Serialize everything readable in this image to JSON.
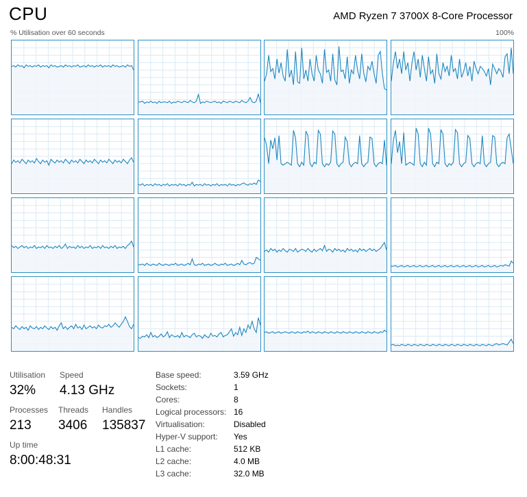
{
  "header": {
    "title": "CPU",
    "processor": "AMD Ryzen 7 3700X 8-Core Processor",
    "graph_caption": "% Utilisation over 60 seconds",
    "graph_max": "100%"
  },
  "colors": {
    "line": "#1c86c0",
    "fill": "#f1f6fb",
    "grid": "#d9eaf4",
    "border": "#2a8fc2"
  },
  "graphs": [
    {
      "logical_processor": 1,
      "levels": [
        0.65,
        0.66,
        0.64,
        0.67,
        0.65,
        0.66,
        0.63,
        0.67,
        0.65,
        0.66,
        0.64,
        0.66,
        0.65,
        0.67,
        0.64,
        0.66,
        0.65,
        0.66,
        0.63,
        0.67,
        0.65,
        0.66,
        0.64,
        0.65,
        0.66,
        0.64,
        0.67,
        0.65,
        0.66,
        0.64,
        0.66,
        0.65,
        0.67,
        0.64,
        0.65,
        0.66,
        0.64,
        0.67,
        0.65,
        0.66,
        0.64,
        0.66,
        0.65,
        0.67,
        0.64,
        0.66,
        0.65,
        0.66,
        0.64,
        0.67,
        0.65,
        0.66,
        0.64,
        0.65,
        0.66,
        0.64,
        0.67,
        0.65,
        0.66,
        0.6
      ]
    },
    {
      "logical_processor": 2,
      "levels": [
        0.17,
        0.17,
        0.18,
        0.15,
        0.17,
        0.16,
        0.18,
        0.16,
        0.17,
        0.15,
        0.18,
        0.16,
        0.17,
        0.17,
        0.16,
        0.18,
        0.15,
        0.17,
        0.16,
        0.18,
        0.17,
        0.16,
        0.18,
        0.17,
        0.16,
        0.19,
        0.17,
        0.16,
        0.18,
        0.27,
        0.15,
        0.17,
        0.16,
        0.18,
        0.17,
        0.16,
        0.17,
        0.18,
        0.16,
        0.17,
        0.15,
        0.18,
        0.17,
        0.16,
        0.18,
        0.17,
        0.16,
        0.18,
        0.17,
        0.16,
        0.19,
        0.17,
        0.16,
        0.18,
        0.23,
        0.17,
        0.16,
        0.18,
        0.28,
        0.16
      ]
    },
    {
      "logical_processor": 3,
      "levels": [
        0.45,
        0.55,
        0.8,
        0.58,
        0.62,
        0.48,
        0.75,
        0.56,
        0.7,
        0.52,
        0.45,
        0.88,
        0.5,
        0.6,
        0.4,
        0.85,
        0.44,
        0.42,
        0.9,
        0.48,
        0.6,
        0.45,
        0.75,
        0.55,
        0.45,
        0.8,
        0.6,
        0.55,
        0.42,
        0.88,
        0.57,
        0.6,
        0.45,
        0.82,
        0.47,
        0.4,
        0.92,
        0.58,
        0.6,
        0.48,
        0.78,
        0.42,
        0.6,
        0.55,
        0.8,
        0.6,
        0.48,
        0.82,
        0.56,
        0.44,
        0.65,
        0.6,
        0.72,
        0.55,
        0.42,
        0.8,
        0.85,
        0.55,
        0.35,
        0.33
      ]
    },
    {
      "logical_processor": 4,
      "levels": [
        0.45,
        0.7,
        0.85,
        0.62,
        0.75,
        0.55,
        0.85,
        0.6,
        0.7,
        0.45,
        0.7,
        0.85,
        0.6,
        0.75,
        0.5,
        0.8,
        0.62,
        0.45,
        0.78,
        0.55,
        0.6,
        0.42,
        0.82,
        0.55,
        0.48,
        0.7,
        0.58,
        0.65,
        0.52,
        0.8,
        0.58,
        0.62,
        0.48,
        0.75,
        0.5,
        0.58,
        0.7,
        0.52,
        0.65,
        0.45,
        0.72,
        0.62,
        0.55,
        0.65,
        0.62,
        0.58,
        0.52,
        0.62,
        0.4,
        0.68,
        0.62,
        0.55,
        0.62,
        0.58,
        0.5,
        0.78,
        0.82,
        0.55,
        0.9,
        0.55
      ]
    },
    {
      "logical_processor": 5,
      "levels": [
        0.4,
        0.45,
        0.42,
        0.44,
        0.41,
        0.46,
        0.43,
        0.4,
        0.45,
        0.42,
        0.44,
        0.41,
        0.47,
        0.43,
        0.4,
        0.45,
        0.42,
        0.44,
        0.38,
        0.46,
        0.43,
        0.41,
        0.45,
        0.42,
        0.44,
        0.41,
        0.46,
        0.43,
        0.4,
        0.45,
        0.42,
        0.44,
        0.41,
        0.46,
        0.43,
        0.4,
        0.45,
        0.42,
        0.44,
        0.41,
        0.46,
        0.43,
        0.4,
        0.45,
        0.42,
        0.44,
        0.41,
        0.46,
        0.43,
        0.4,
        0.45,
        0.42,
        0.44,
        0.41,
        0.46,
        0.43,
        0.4,
        0.45,
        0.48,
        0.42
      ]
    },
    {
      "logical_processor": 6,
      "levels": [
        0.12,
        0.11,
        0.13,
        0.1,
        0.12,
        0.11,
        0.12,
        0.1,
        0.13,
        0.11,
        0.12,
        0.1,
        0.12,
        0.11,
        0.13,
        0.1,
        0.12,
        0.11,
        0.12,
        0.1,
        0.13,
        0.11,
        0.12,
        0.1,
        0.12,
        0.11,
        0.15,
        0.1,
        0.12,
        0.11,
        0.12,
        0.1,
        0.13,
        0.11,
        0.12,
        0.1,
        0.12,
        0.11,
        0.13,
        0.1,
        0.12,
        0.11,
        0.12,
        0.1,
        0.13,
        0.11,
        0.12,
        0.1,
        0.12,
        0.11,
        0.13,
        0.14,
        0.12,
        0.11,
        0.13,
        0.12,
        0.14,
        0.12,
        0.18,
        0.16
      ]
    },
    {
      "logical_processor": 7,
      "levels": [
        0.75,
        0.65,
        0.4,
        0.72,
        0.6,
        0.75,
        0.45,
        0.78,
        0.4,
        0.38,
        0.4,
        0.42,
        0.4,
        0.38,
        0.85,
        0.75,
        0.4,
        0.36,
        0.42,
        0.38,
        0.84,
        0.78,
        0.4,
        0.36,
        0.42,
        0.4,
        0.85,
        0.8,
        0.4,
        0.36,
        0.4,
        0.38,
        0.42,
        0.84,
        0.8,
        0.4,
        0.36,
        0.4,
        0.42,
        0.76,
        0.7,
        0.4,
        0.36,
        0.4,
        0.42,
        0.4,
        0.78,
        0.4,
        0.36,
        0.4,
        0.42,
        0.76,
        0.74,
        0.4,
        0.36,
        0.4,
        0.42,
        0.4,
        0.72,
        0.38
      ]
    },
    {
      "logical_processor": 8,
      "levels": [
        0.4,
        0.72,
        0.85,
        0.55,
        0.7,
        0.4,
        0.82,
        0.38,
        0.4,
        0.42,
        0.4,
        0.38,
        0.88,
        0.8,
        0.4,
        0.36,
        0.42,
        0.38,
        0.88,
        0.8,
        0.4,
        0.36,
        0.42,
        0.4,
        0.86,
        0.8,
        0.4,
        0.36,
        0.4,
        0.38,
        0.42,
        0.86,
        0.82,
        0.4,
        0.36,
        0.4,
        0.42,
        0.78,
        0.74,
        0.4,
        0.36,
        0.4,
        0.42,
        0.4,
        0.78,
        0.4,
        0.36,
        0.4,
        0.42,
        0.78,
        0.76,
        0.4,
        0.36,
        0.4,
        0.42,
        0.4,
        0.75,
        0.8,
        0.6,
        0.4
      ]
    },
    {
      "logical_processor": 9,
      "levels": [
        0.36,
        0.33,
        0.35,
        0.32,
        0.34,
        0.36,
        0.33,
        0.35,
        0.32,
        0.34,
        0.33,
        0.36,
        0.32,
        0.34,
        0.33,
        0.35,
        0.32,
        0.36,
        0.33,
        0.34,
        0.32,
        0.35,
        0.33,
        0.36,
        0.32,
        0.34,
        0.38,
        0.32,
        0.35,
        0.33,
        0.34,
        0.32,
        0.36,
        0.33,
        0.35,
        0.32,
        0.34,
        0.33,
        0.36,
        0.32,
        0.34,
        0.33,
        0.35,
        0.32,
        0.36,
        0.33,
        0.34,
        0.32,
        0.35,
        0.33,
        0.36,
        0.32,
        0.34,
        0.33,
        0.35,
        0.32,
        0.36,
        0.38,
        0.42,
        0.34
      ]
    },
    {
      "logical_processor": 10,
      "levels": [
        0.1,
        0.1,
        0.11,
        0.09,
        0.12,
        0.1,
        0.09,
        0.11,
        0.1,
        0.09,
        0.12,
        0.1,
        0.09,
        0.11,
        0.1,
        0.09,
        0.11,
        0.1,
        0.12,
        0.09,
        0.1,
        0.11,
        0.09,
        0.1,
        0.12,
        0.1,
        0.18,
        0.1,
        0.09,
        0.11,
        0.1,
        0.12,
        0.09,
        0.1,
        0.11,
        0.09,
        0.1,
        0.12,
        0.1,
        0.09,
        0.11,
        0.1,
        0.12,
        0.09,
        0.1,
        0.11,
        0.09,
        0.1,
        0.12,
        0.1,
        0.16,
        0.11,
        0.1,
        0.12,
        0.13,
        0.11,
        0.12,
        0.2,
        0.18,
        0.16
      ]
    },
    {
      "logical_processor": 11,
      "levels": [
        0.28,
        0.3,
        0.27,
        0.32,
        0.29,
        0.31,
        0.27,
        0.3,
        0.28,
        0.32,
        0.29,
        0.27,
        0.31,
        0.3,
        0.28,
        0.32,
        0.27,
        0.29,
        0.31,
        0.3,
        0.28,
        0.32,
        0.29,
        0.27,
        0.31,
        0.28,
        0.3,
        0.32,
        0.29,
        0.36,
        0.28,
        0.31,
        0.3,
        0.27,
        0.32,
        0.29,
        0.31,
        0.28,
        0.3,
        0.27,
        0.32,
        0.29,
        0.31,
        0.28,
        0.3,
        0.27,
        0.32,
        0.29,
        0.31,
        0.28,
        0.3,
        0.32,
        0.29,
        0.31,
        0.28,
        0.3,
        0.32,
        0.36,
        0.4,
        0.3
      ]
    },
    {
      "logical_processor": 12,
      "levels": [
        0.08,
        0.08,
        0.09,
        0.07,
        0.08,
        0.09,
        0.07,
        0.08,
        0.09,
        0.07,
        0.08,
        0.09,
        0.07,
        0.08,
        0.09,
        0.07,
        0.08,
        0.09,
        0.07,
        0.08,
        0.09,
        0.07,
        0.08,
        0.09,
        0.07,
        0.08,
        0.09,
        0.07,
        0.08,
        0.09,
        0.07,
        0.08,
        0.09,
        0.07,
        0.08,
        0.09,
        0.07,
        0.08,
        0.09,
        0.07,
        0.08,
        0.09,
        0.07,
        0.08,
        0.09,
        0.07,
        0.08,
        0.09,
        0.07,
        0.08,
        0.09,
        0.07,
        0.08,
        0.09,
        0.08,
        0.1,
        0.09,
        0.08,
        0.15,
        0.12
      ]
    },
    {
      "logical_processor": 13,
      "levels": [
        0.32,
        0.3,
        0.34,
        0.31,
        0.29,
        0.33,
        0.3,
        0.32,
        0.28,
        0.34,
        0.31,
        0.3,
        0.33,
        0.29,
        0.32,
        0.3,
        0.34,
        0.31,
        0.29,
        0.33,
        0.3,
        0.32,
        0.28,
        0.34,
        0.38,
        0.3,
        0.33,
        0.29,
        0.32,
        0.34,
        0.3,
        0.36,
        0.31,
        0.33,
        0.29,
        0.35,
        0.3,
        0.32,
        0.34,
        0.31,
        0.33,
        0.3,
        0.35,
        0.32,
        0.31,
        0.34,
        0.33,
        0.36,
        0.32,
        0.34,
        0.38,
        0.35,
        0.32,
        0.36,
        0.4,
        0.46,
        0.4,
        0.33,
        0.3,
        0.36
      ]
    },
    {
      "logical_processor": 14,
      "levels": [
        0.18,
        0.17,
        0.2,
        0.19,
        0.22,
        0.18,
        0.25,
        0.19,
        0.21,
        0.18,
        0.2,
        0.23,
        0.19,
        0.21,
        0.26,
        0.18,
        0.22,
        0.2,
        0.19,
        0.21,
        0.18,
        0.25,
        0.19,
        0.21,
        0.2,
        0.18,
        0.22,
        0.24,
        0.19,
        0.21,
        0.2,
        0.17,
        0.22,
        0.19,
        0.18,
        0.24,
        0.2,
        0.21,
        0.19,
        0.23,
        0.25,
        0.19,
        0.21,
        0.22,
        0.26,
        0.3,
        0.2,
        0.25,
        0.22,
        0.32,
        0.21,
        0.3,
        0.25,
        0.35,
        0.3,
        0.4,
        0.3,
        0.25,
        0.45,
        0.35
      ]
    },
    {
      "logical_processor": 15,
      "levels": [
        0.25,
        0.26,
        0.24,
        0.25,
        0.26,
        0.24,
        0.25,
        0.26,
        0.24,
        0.25,
        0.26,
        0.25,
        0.24,
        0.26,
        0.25,
        0.24,
        0.26,
        0.25,
        0.24,
        0.26,
        0.25,
        0.27,
        0.24,
        0.26,
        0.25,
        0.24,
        0.26,
        0.25,
        0.24,
        0.26,
        0.25,
        0.24,
        0.26,
        0.25,
        0.24,
        0.26,
        0.25,
        0.24,
        0.26,
        0.25,
        0.24,
        0.26,
        0.25,
        0.24,
        0.26,
        0.25,
        0.24,
        0.26,
        0.25,
        0.24,
        0.26,
        0.25,
        0.24,
        0.26,
        0.25,
        0.24,
        0.26,
        0.25,
        0.28,
        0.26
      ]
    },
    {
      "logical_processor": 16,
      "levels": [
        0.08,
        0.09,
        0.07,
        0.08,
        0.07,
        0.09,
        0.08,
        0.07,
        0.09,
        0.08,
        0.07,
        0.09,
        0.08,
        0.07,
        0.09,
        0.08,
        0.07,
        0.09,
        0.08,
        0.07,
        0.09,
        0.08,
        0.07,
        0.09,
        0.08,
        0.07,
        0.09,
        0.08,
        0.07,
        0.09,
        0.08,
        0.07,
        0.09,
        0.08,
        0.07,
        0.09,
        0.08,
        0.07,
        0.09,
        0.08,
        0.07,
        0.09,
        0.08,
        0.07,
        0.09,
        0.08,
        0.07,
        0.09,
        0.08,
        0.07,
        0.09,
        0.1,
        0.08,
        0.09,
        0.1,
        0.09,
        0.08,
        0.12,
        0.16,
        0.1
      ]
    }
  ],
  "stats": {
    "utilisation_label": "Utilisation",
    "utilisation_value": "32%",
    "speed_label": "Speed",
    "speed_value": "4.13 GHz",
    "processes_label": "Processes",
    "processes_value": "213",
    "threads_label": "Threads",
    "threads_value": "3406",
    "handles_label": "Handles",
    "handles_value": "135837",
    "uptime_label": "Up time",
    "uptime_value": "8:00:48:31"
  },
  "specs": {
    "base_speed_label": "Base speed:",
    "base_speed_value": "3.59 GHz",
    "sockets_label": "Sockets:",
    "sockets_value": "1",
    "cores_label": "Cores:",
    "cores_value": "8",
    "logical_processors_label": "Logical processors:",
    "logical_processors_value": "16",
    "virtualisation_label": "Virtualisation:",
    "virtualisation_value": "Disabled",
    "hyperv_label": "Hyper-V support:",
    "hyperv_value": "Yes",
    "l1_label": "L1 cache:",
    "l1_value": "512 KB",
    "l2_label": "L2 cache:",
    "l2_value": "4.0 MB",
    "l3_label": "L3 cache:",
    "l3_value": "32.0 MB"
  }
}
